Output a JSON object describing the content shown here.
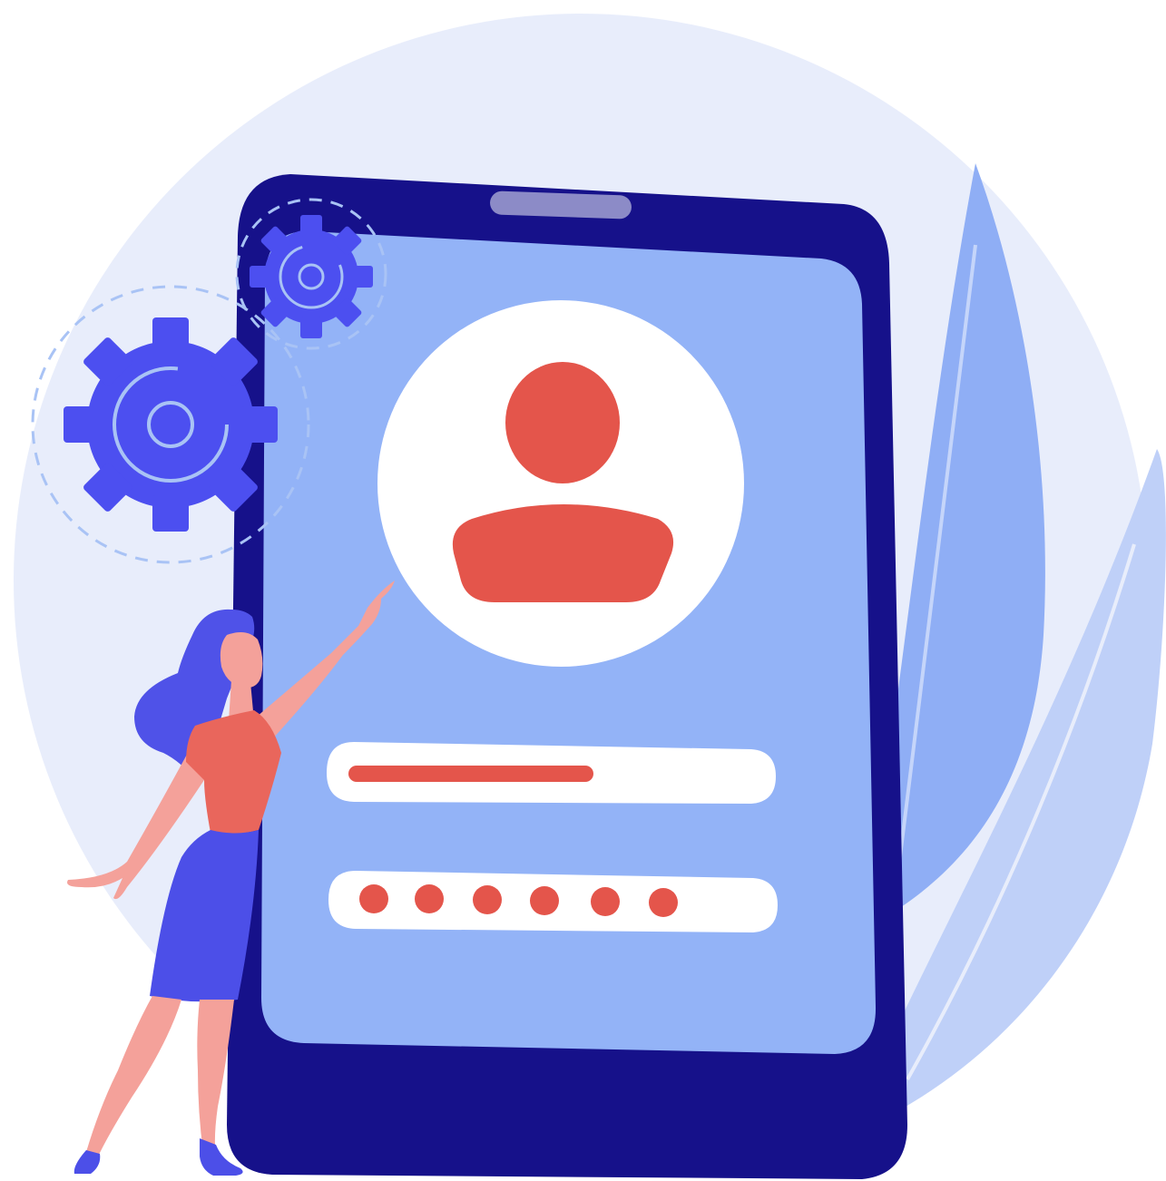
{
  "illustration": {
    "colors": {
      "background_circle": "#E8EDFB",
      "leaf_dark": "#8FAEF5",
      "leaf_light": "#BFD0F8",
      "device_frame": "#16118A",
      "device_frame_dark": "#0E0A66",
      "speaker_slot": "#8C8BC7",
      "screen": "#93B3F7",
      "white": "#FFFFFF",
      "accent_red": "#E4554B",
      "gear": "#4C4FF0",
      "gear_lines": "#A9C3F5",
      "skin": "#F4A19A",
      "hair": "#4F52E8",
      "top": "#E9665C",
      "skirt": "#4C4FE8",
      "shoes": "#4C4FE8"
    },
    "icons": {
      "avatar": "user-avatar-icon",
      "gear_large": "gear-icon",
      "gear_small": "gear-icon"
    },
    "login_form": {
      "username_field": "filled-text-bar",
      "password_dot_count": 6
    }
  }
}
